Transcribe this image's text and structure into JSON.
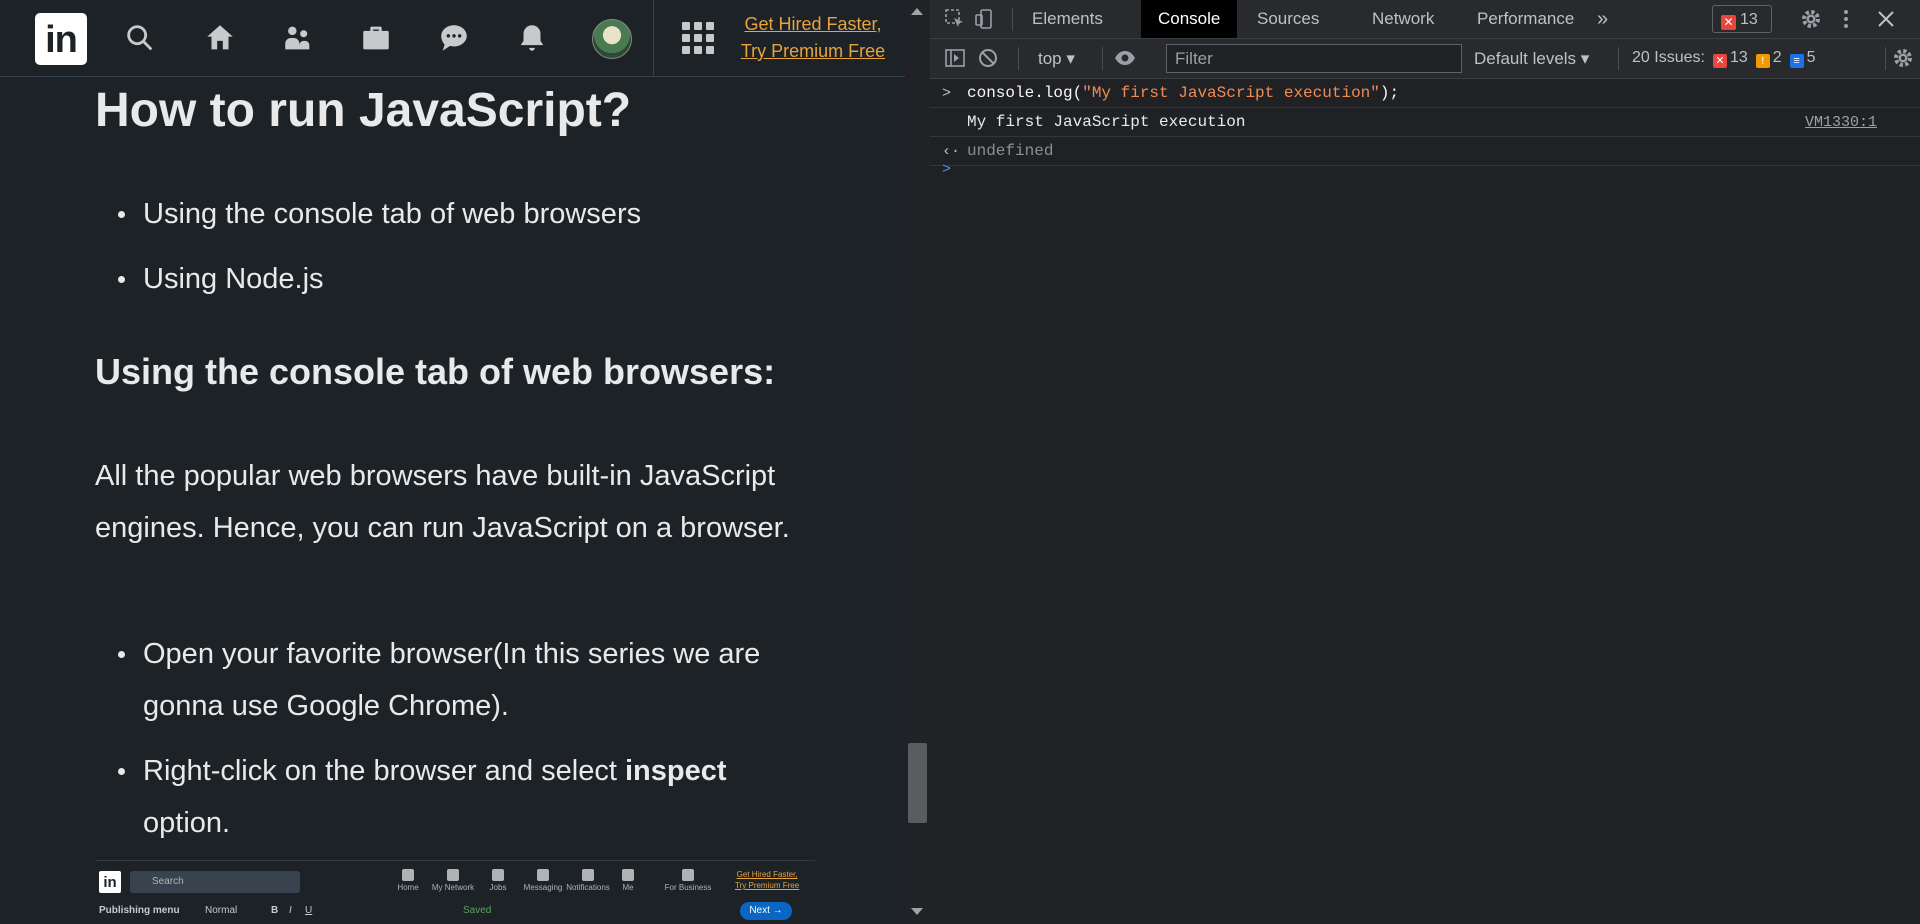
{
  "linkedin_nav": {
    "logo_text": "in",
    "icons": [
      "search-icon",
      "home-icon",
      "network-icon",
      "jobs-icon",
      "messaging-icon",
      "notifications-icon",
      "avatar",
      "grid-icon"
    ],
    "premium_line1": "Get Hired Faster,",
    "premium_line2": "Try Premium Free",
    "premium_color": "#e7a33e"
  },
  "article": {
    "heading": "How to run JavaScript?",
    "methods": [
      "Using the console tab of web browsers",
      "Using Node.js"
    ],
    "subheading": "Using the console tab of web browsers:",
    "paragraph": "All the popular web browsers have built-in JavaScript engines. Hence, you can run JavaScript on a browser.",
    "steps": [
      {
        "text": "Open your favorite browser(In this series we are gonna use Google Chrome).",
        "bold": ""
      },
      {
        "text": "Right-click on the browser and select ",
        "bold": "inspect",
        "suffix": " option."
      }
    ]
  },
  "mini_screenshot": {
    "search_placeholder": "Search",
    "nav_labels": [
      "Home",
      "My Network",
      "Jobs",
      "Messaging",
      "Notifications",
      "Me",
      "For Business"
    ],
    "premium_line1": "Get Hired Faster,",
    "premium_line2": "Try Premium Free",
    "toolbar": [
      "Publishing menu",
      "Normal",
      "B",
      "I",
      "U",
      "Saved"
    ],
    "next_label": "Next"
  },
  "devtools": {
    "tabs": [
      "Elements",
      "Console",
      "Sources",
      "Network",
      "Performance"
    ],
    "active_tab": "Console",
    "more_tabs": "»",
    "error_count": "13",
    "context": "top",
    "filter_placeholder": "Filter",
    "levels": "Default levels",
    "issues_label": "20 Issues:",
    "issues_errors": "13",
    "issues_warnings": "2",
    "issues_info": "5",
    "console": {
      "command_fn": "console.log(",
      "command_str": "\"My first JavaScript execution\"",
      "command_end": ");",
      "output": "My first JavaScript execution",
      "output_source": "VM1330:1",
      "return_value": "undefined"
    },
    "colors": {
      "error": "#e8453c",
      "warning": "#f29900",
      "info": "#1a73e8",
      "string": "#f28b54"
    }
  }
}
